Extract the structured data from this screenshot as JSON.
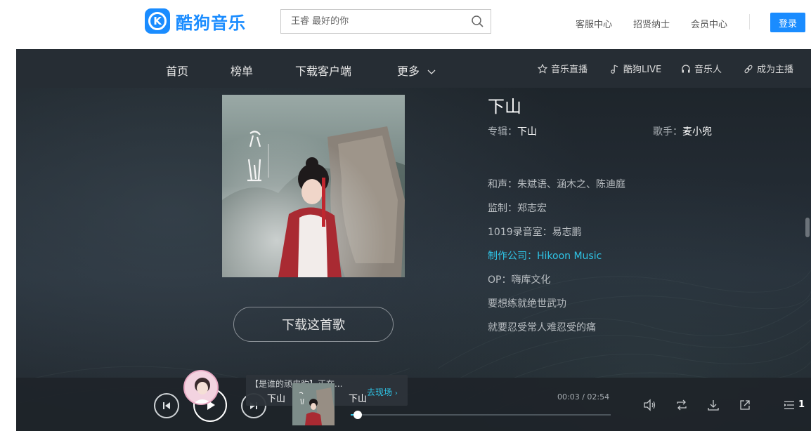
{
  "header": {
    "logo_text": "酷狗音乐",
    "logo_glyph": "K",
    "search": {
      "placeholder": "王睿 最好的你"
    },
    "links": [
      "客服中心",
      "招贤纳士",
      "会员中心"
    ],
    "login_label": "登录",
    "brand_color": "#1a8cff"
  },
  "nav": {
    "items": [
      "首页",
      "榜单",
      "下载客户端",
      "更多"
    ],
    "right": [
      {
        "icon": "star-icon",
        "label": "音乐直播"
      },
      {
        "icon": "music-note-icon",
        "label": "酷狗LIVE"
      },
      {
        "icon": "headphones-icon",
        "label": "音乐人"
      },
      {
        "icon": "link-icon",
        "label": "成为主播"
      }
    ]
  },
  "song": {
    "title": "下山",
    "album_label": "专辑：",
    "album": "下山",
    "singer_label": "歌手：",
    "singer": "麦小兜",
    "download_label": "下载这首歌",
    "lyrics": [
      {
        "text": "和声：朱斌语、涵木之、陈迪庭",
        "highlight": false
      },
      {
        "text": "监制：郑志宏",
        "highlight": false
      },
      {
        "text": "1019录音室：易志鹏",
        "highlight": false
      },
      {
        "text": "制作公司：Hikoon Music",
        "highlight": true
      },
      {
        "text": "OP：嗨库文化",
        "highlight": false
      },
      {
        "text": "要想练就绝世武功",
        "highlight": false
      },
      {
        "text": "就要忍受常人难忍受的痛",
        "highlight": false
      }
    ],
    "highlight_color": "#2fc4e6"
  },
  "player": {
    "live_text": "【是谁的顽皮豹】正在...",
    "live_link": "去现场",
    "left_title": "下山",
    "title": "下山",
    "time": "00:03 / 02:54",
    "progress": 0.017,
    "playlist_count": "1"
  }
}
